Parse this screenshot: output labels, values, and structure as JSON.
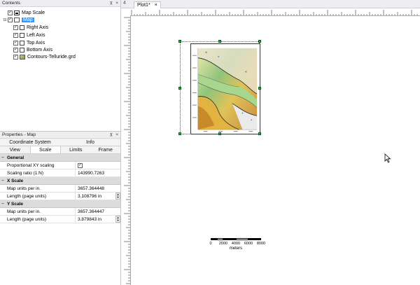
{
  "contents_panel": {
    "title": "Contents",
    "items": [
      {
        "label": "Map Scale"
      },
      {
        "label": "Map"
      },
      {
        "label": "Right Axis"
      },
      {
        "label": "Left Axis"
      },
      {
        "label": "Top Axis"
      },
      {
        "label": "Bottom Axis"
      },
      {
        "label": "Contours-Telluride.grd"
      }
    ]
  },
  "properties_panel": {
    "title": "Properties - Map",
    "tabs_row1": [
      "Coordinate System",
      "Info"
    ],
    "tabs_row2": [
      "View",
      "Scale",
      "Limits",
      "Frame"
    ],
    "sections": {
      "general": "General",
      "xscale": "X Scale",
      "yscale": "Y Scale"
    },
    "rows": {
      "proportional_label": "Proportional XY scaling",
      "ratio_label": "Scaling ratio (1:N)",
      "ratio_value": "143990.7263",
      "x_units_label": "Map units per in.",
      "x_units_value": "3657.364448",
      "x_len_label": "Length (page units)",
      "x_len_value": "3.108796 in",
      "y_units_label": "Map units per in.",
      "y_units_value": "3657.364447",
      "y_len_label": "Length (page units)",
      "y_len_value": "3.879843 in"
    }
  },
  "document": {
    "tab_label": "Plot1*",
    "tab_close": "×",
    "pin": "4"
  },
  "scale_bar": {
    "ticks": [
      "0",
      "2000",
      "4000",
      "6000",
      "8000"
    ],
    "units": "meters"
  },
  "colors": {
    "selection": "#3399ff",
    "handle": "#20b040"
  }
}
